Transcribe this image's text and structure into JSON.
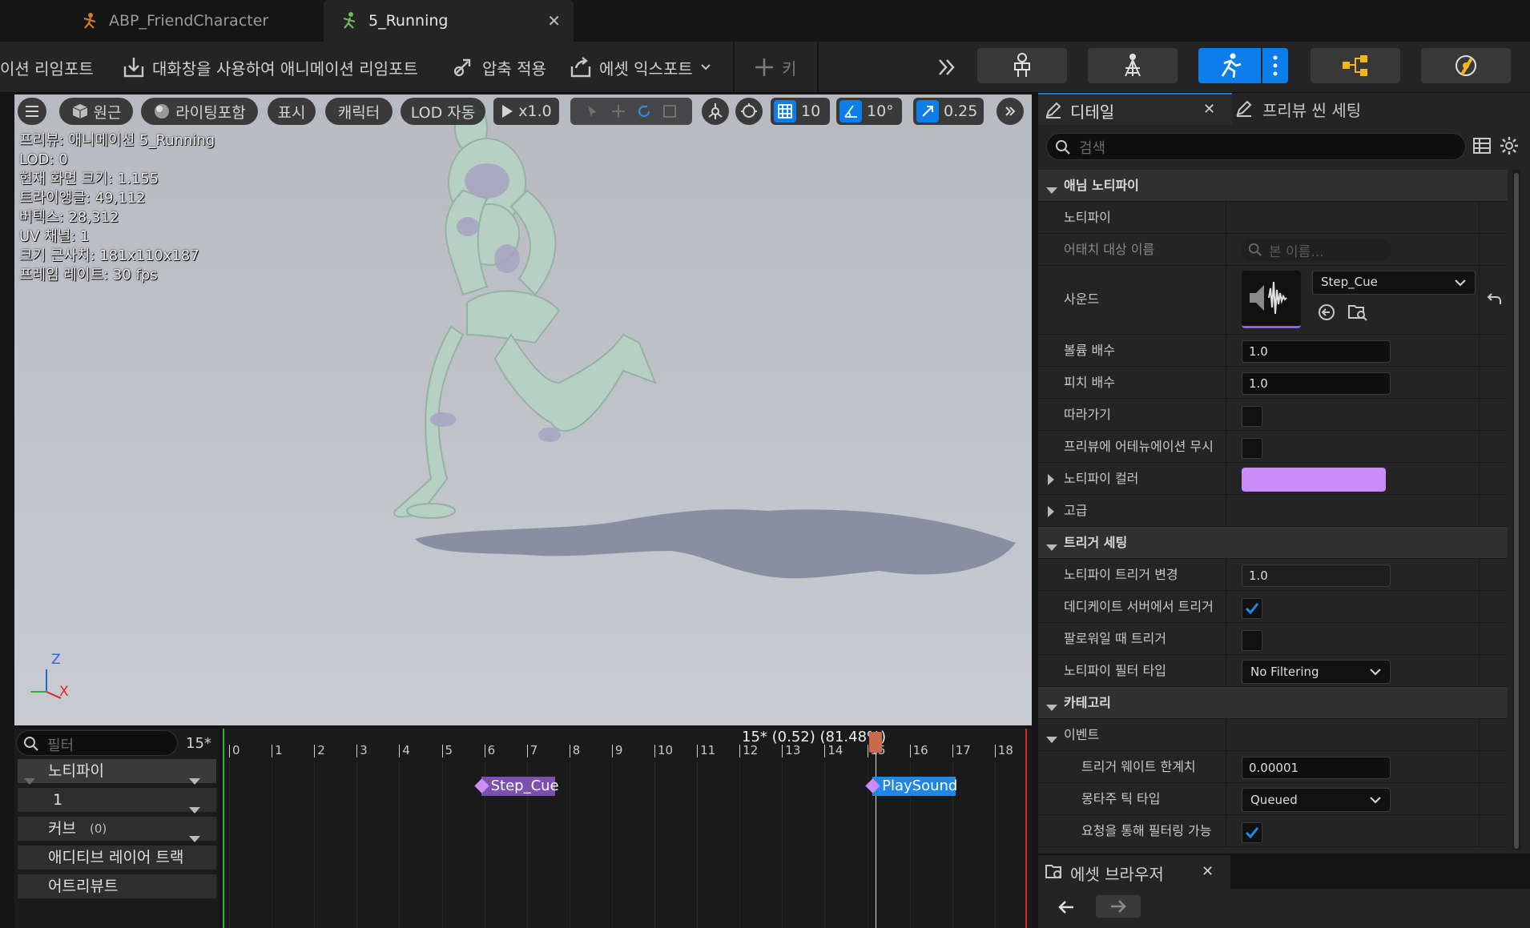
{
  "tabs": [
    {
      "label": "ABP_FriendCharacter",
      "icon": "animblueprint-icon",
      "active": false
    },
    {
      "label": "5_Running",
      "icon": "animsequence-icon",
      "active": true
    }
  ],
  "toolbar": {
    "reimport": "이션 리임포트",
    "reimport_dialog": "대화창을 사용하여 애니메이션 리임포트",
    "apply_compression": "압축 적용",
    "export_asset": "에셋 익스포트",
    "add_key": "키"
  },
  "viewport": {
    "buttons": {
      "perspective": "원근",
      "lighting": "라이팅포함",
      "show": "표시",
      "character": "캐릭터",
      "lod": "LOD 자동",
      "play_speed": "x1.0",
      "grid_snap": "10",
      "angle_snap": "10°",
      "scale_snap": "0.25"
    },
    "stats": [
      "프리뷰: 애니메이션 5_Running",
      "LOD: 0",
      "현재 화면 크기: 1.155",
      "트라이앵글: 49,112",
      "버텍스: 28,312",
      "UV 채널: 1",
      "크기 근사치: 181x110x187",
      "프레임 레이트: 30 fps"
    ],
    "axis": {
      "z": "Z",
      "x": "X"
    }
  },
  "details": {
    "tab_details": "디테일",
    "tab_preview": "프리뷰 씬 세팅",
    "search_placeholder": "검색",
    "sections": {
      "anim_notify": "애님 노티파이",
      "trigger_settings": "트리거 세팅",
      "category": "카테고리"
    },
    "labels": {
      "notify": "노티파이",
      "attach_name": "어태치 대상 이름",
      "sound": "사운드",
      "volume": "볼륨 배수",
      "pitch": "피치 배수",
      "follow": "따라가기",
      "ignore_attenuation": "프리뷰에 어테뉴에이션 무시",
      "notify_color": "노티파이 컬러",
      "advanced": "고급",
      "trigger_chance": "노티파이 트리거 변경",
      "trigger_dedicated": "데디케이트 서버에서 트리거",
      "trigger_follower": "팔로워일 때 트리거",
      "filter_type": "노티파이 필터 타입",
      "event": "이벤트",
      "trigger_weight": "트리거 웨이트 한계치",
      "montage_tick": "몽타주 틱 타입",
      "filterable": "요청을 통해 필터링 가능"
    },
    "values": {
      "bone_placeholder": "본 이름...",
      "sound_asset": "Step_Cue",
      "volume": "1.0",
      "pitch": "1.0",
      "follow": false,
      "ignore_attenuation": false,
      "notify_color": "#c98cf8",
      "trigger_chance": "1.0",
      "trigger_dedicated": true,
      "trigger_follower": false,
      "filter_type": "No Filtering",
      "trigger_weight": "0.00001",
      "montage_tick": "Queued",
      "filterable": true
    }
  },
  "asset_browser": {
    "tab": "에셋 브라우저"
  },
  "timeline": {
    "filter_placeholder": "필터",
    "frame_display": "15*",
    "status": "15* (0.52) (81.48%)",
    "tracks": [
      {
        "label": "노티파이"
      },
      {
        "label": "1"
      },
      {
        "label": "커브",
        "count": "(0)"
      },
      {
        "label": "애디티브 레이어 트랙"
      },
      {
        "label": "어트리뷰트"
      }
    ],
    "frames": [
      "0",
      "1",
      "2",
      "3",
      "4",
      "5",
      "6",
      "7",
      "8",
      "9",
      "10",
      "11",
      "12",
      "13",
      "14",
      "15",
      "16",
      "17",
      "18"
    ],
    "current_frame": 15.2,
    "notifies": [
      {
        "label": "Step_Cue",
        "frame": 6,
        "color": "#7d4fb0"
      },
      {
        "label": "PlaySound",
        "frame": 15.2,
        "color": "#1f88e6"
      }
    ]
  },
  "colors": {
    "accent": "#0d7ee9",
    "notify_purple": "#c98cf8"
  }
}
